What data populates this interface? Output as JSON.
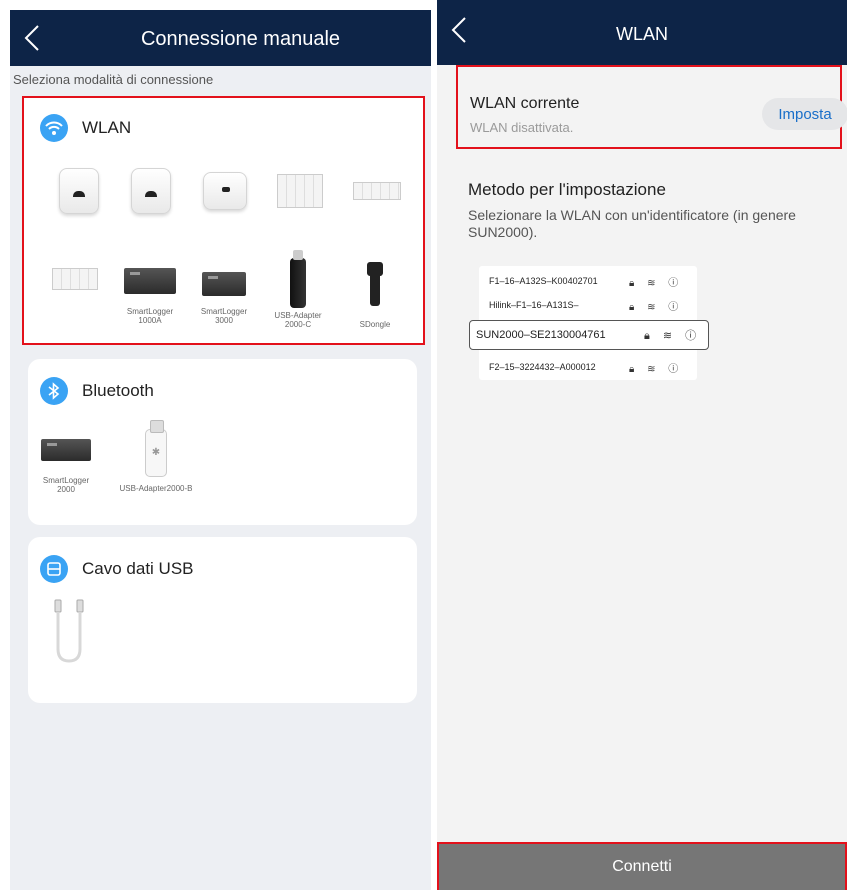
{
  "left": {
    "title": "Connessione manuale",
    "hint": "Seleziona modalità di connessione",
    "wlan": {
      "title": "WLAN",
      "devices": [
        {
          "label": ""
        },
        {
          "label": ""
        },
        {
          "label": ""
        },
        {
          "label": ""
        },
        {
          "label": ""
        },
        {
          "label": ""
        },
        {
          "label": "SmartLogger 1000A"
        },
        {
          "label": "SmartLogger 3000"
        },
        {
          "label": "USB-Adapter 2000-C"
        },
        {
          "label": "SDongle"
        }
      ]
    },
    "bluetooth": {
      "title": "Bluetooth",
      "devices": [
        {
          "label": "SmartLogger 2000"
        },
        {
          "label": "USB-Adapter2000-B"
        }
      ]
    },
    "usb": {
      "title": "Cavo dati USB"
    }
  },
  "right": {
    "title": "WLAN",
    "current": {
      "title": "WLAN corrente",
      "status": "WLAN disattivata.",
      "button": "Imposta"
    },
    "method": {
      "title": "Metodo per l'impostazione",
      "desc": "Selezionare la WLAN con un'identificatore (in genere SUN2000)."
    },
    "networks": [
      {
        "name": "F1–16–A132S–K00402701"
      },
      {
        "name": "Hilink–F1–16–A131S–"
      },
      {
        "name": "SUN2000–SE2130004761"
      },
      {
        "name": "F2–15–3224432–A000012"
      }
    ],
    "connect": "Connetti"
  },
  "colors": {
    "topbar": "#0d2447",
    "accent": "#3aa3f4",
    "highlight": "#e3111b"
  }
}
